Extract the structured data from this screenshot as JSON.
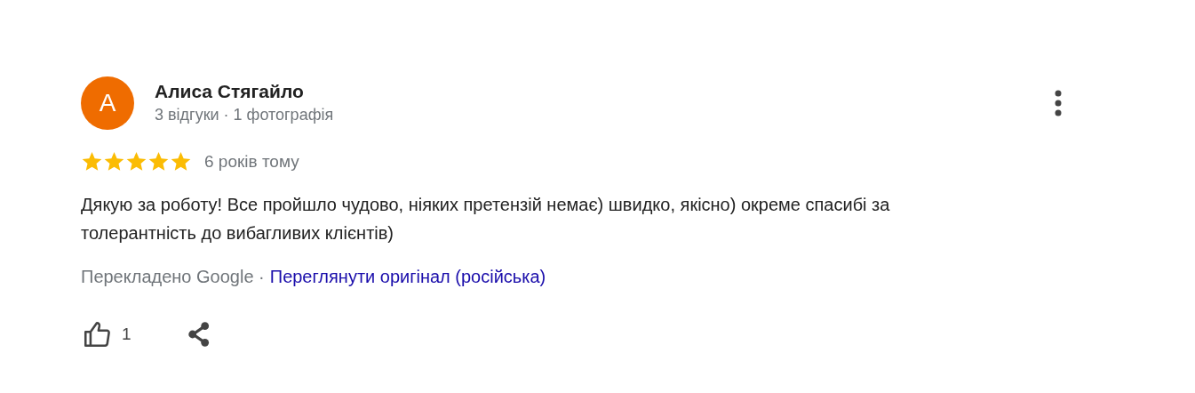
{
  "review": {
    "avatar_letter": "A",
    "author": "Алиса Стягайло",
    "meta": "3 відгуки · 1 фотографія",
    "stars": 5,
    "time": "6 років тому",
    "text": "Дякую за роботу! Все пройшло чудово, ніяких претензій немає) швидко, якісно) окреме спасибі за толерантність до вибагливих клієнтів)",
    "translated": "Перекладено Google ·",
    "original_link": "Переглянути оригінал (російська)",
    "likes": "1"
  }
}
